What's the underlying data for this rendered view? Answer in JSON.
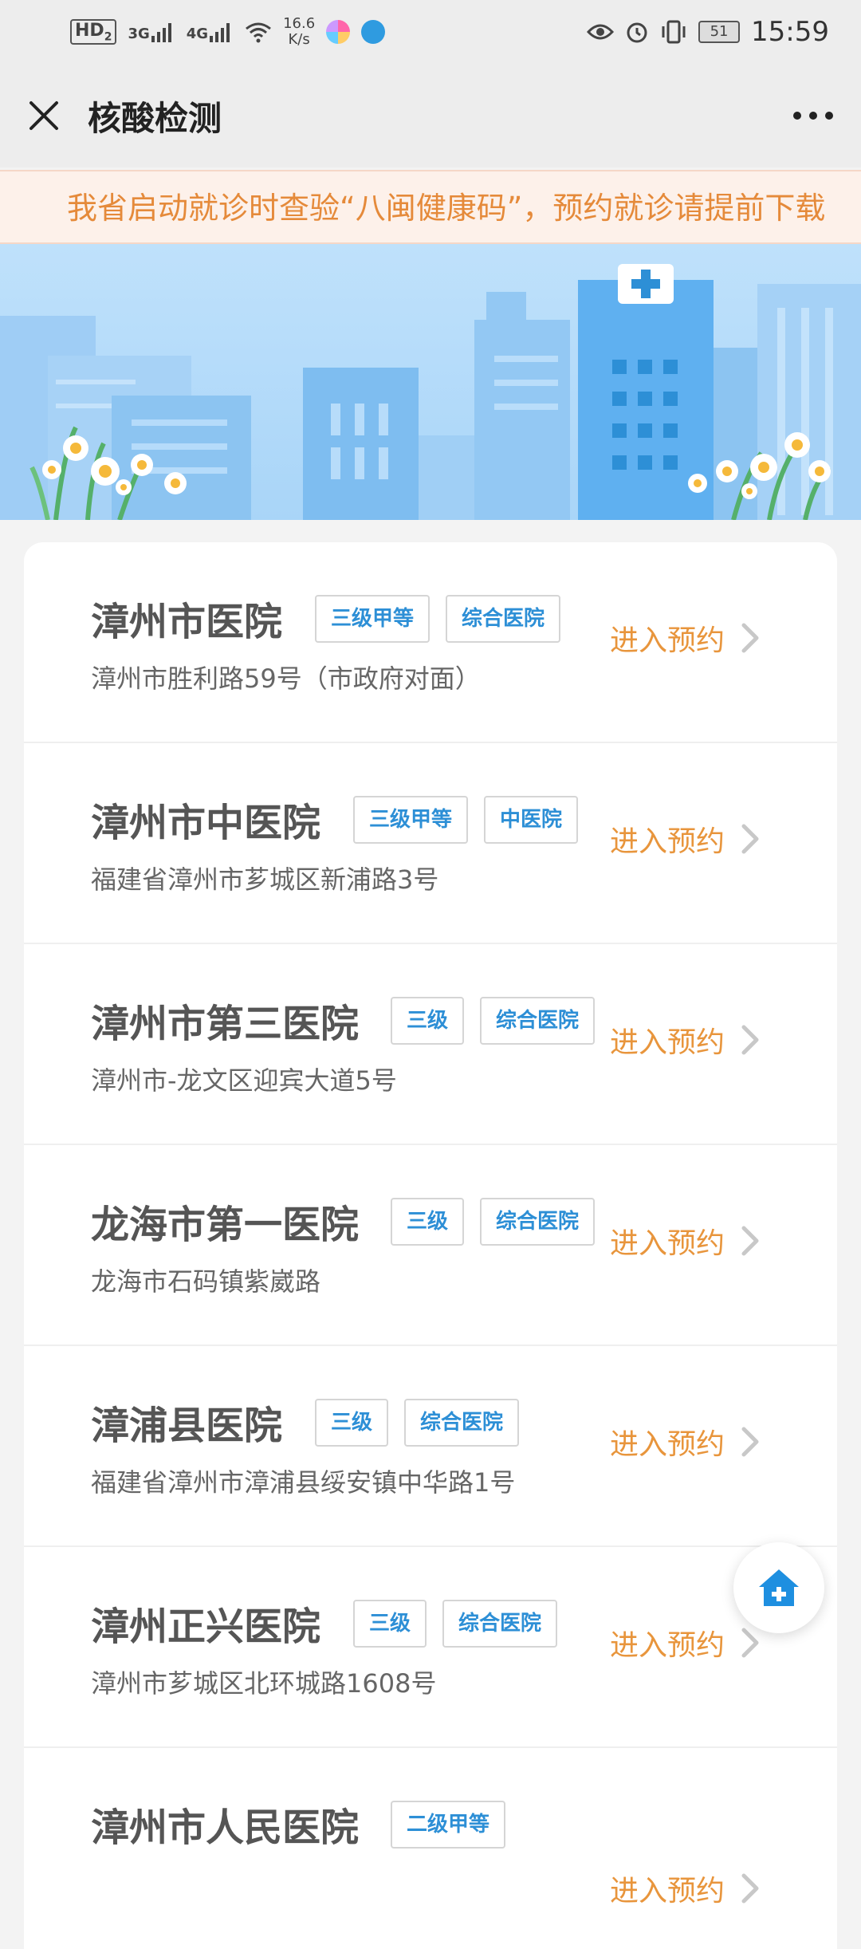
{
  "status_bar": {
    "hd": "HD",
    "hd_sub": "2",
    "net1": "3G",
    "net2": "4G",
    "speed_value": "16.6",
    "speed_unit": "K/s",
    "battery": "51",
    "time": "15:59"
  },
  "header": {
    "title": "核酸检测"
  },
  "notice": {
    "text": "我省启动就诊时查验“八闽健康码”，预约就诊请提前下载"
  },
  "hospitals": [
    {
      "name": "漳州市医院",
      "tags": [
        "三级甲等",
        "综合医院"
      ],
      "address": "漳州市胜利路59号（市政府对面）",
      "action": "进入预约"
    },
    {
      "name": "漳州市中医院",
      "tags": [
        "三级甲等",
        "中医院"
      ],
      "address": "福建省漳州市芗城区新浦路3号",
      "action": "进入预约"
    },
    {
      "name": "漳州市第三医院",
      "tags": [
        "三级",
        "综合医院"
      ],
      "address": "漳州市-龙文区迎宾大道5号",
      "action": "进入预约"
    },
    {
      "name": "龙海市第一医院",
      "tags": [
        "三级",
        "综合医院"
      ],
      "address": "龙海市石码镇紫崴路",
      "action": "进入预约"
    },
    {
      "name": "漳浦县医院",
      "tags": [
        "三级",
        "综合医院"
      ],
      "address": "福建省漳州市漳浦县绥安镇中华路1号",
      "action": "进入预约"
    },
    {
      "name": "漳州正兴医院",
      "tags": [
        "三级",
        "综合医院"
      ],
      "address": "漳州市芗城区北环城路1608号",
      "action": "进入预约"
    },
    {
      "name": "漳州市人民医院",
      "tags": [
        "二级甲等"
      ],
      "address": "",
      "action": "进入预约"
    }
  ],
  "colors": {
    "accent_orange": "#e8953c",
    "tag_blue": "#2d8fd6",
    "hero_sky": "#bfe1fb"
  },
  "icons": {
    "close": "close-icon",
    "more": "more-icon",
    "chevron": "chevron-right-icon",
    "home": "home-icon"
  }
}
